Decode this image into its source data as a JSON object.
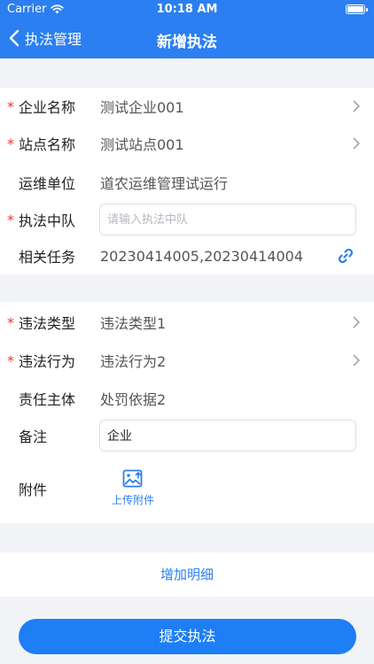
{
  "status_bar": {
    "carrier": "Carrier",
    "time": "10:18 AM"
  },
  "nav": {
    "back_label": "执法管理",
    "title": "新增执法"
  },
  "section1": {
    "company": {
      "label": "企业名称",
      "value": "测试企业001"
    },
    "site": {
      "label": "站点名称",
      "value": "测试站点001"
    },
    "ops_unit": {
      "label": "运维单位",
      "value": "道农运维管理试运行"
    },
    "squad": {
      "label": "执法中队",
      "placeholder": "请输入执法中队"
    },
    "tasks": {
      "label": "相关任务",
      "value": "20230414005,20230414004"
    }
  },
  "section2": {
    "violation_type": {
      "label": "违法类型",
      "value": "违法类型1"
    },
    "violation_act": {
      "label": "违法行为",
      "value": "违法行为2"
    },
    "responsible": {
      "label": "责任主体",
      "value": "处罚依据2"
    },
    "remark": {
      "label": "备注",
      "value": "企业"
    },
    "attachment": {
      "label": "附件",
      "upload_label": "上传附件"
    }
  },
  "actions": {
    "add_detail": "增加明细",
    "submit": "提交执法"
  },
  "colors": {
    "primary": "#2b7ff0",
    "required": "#e53935"
  }
}
